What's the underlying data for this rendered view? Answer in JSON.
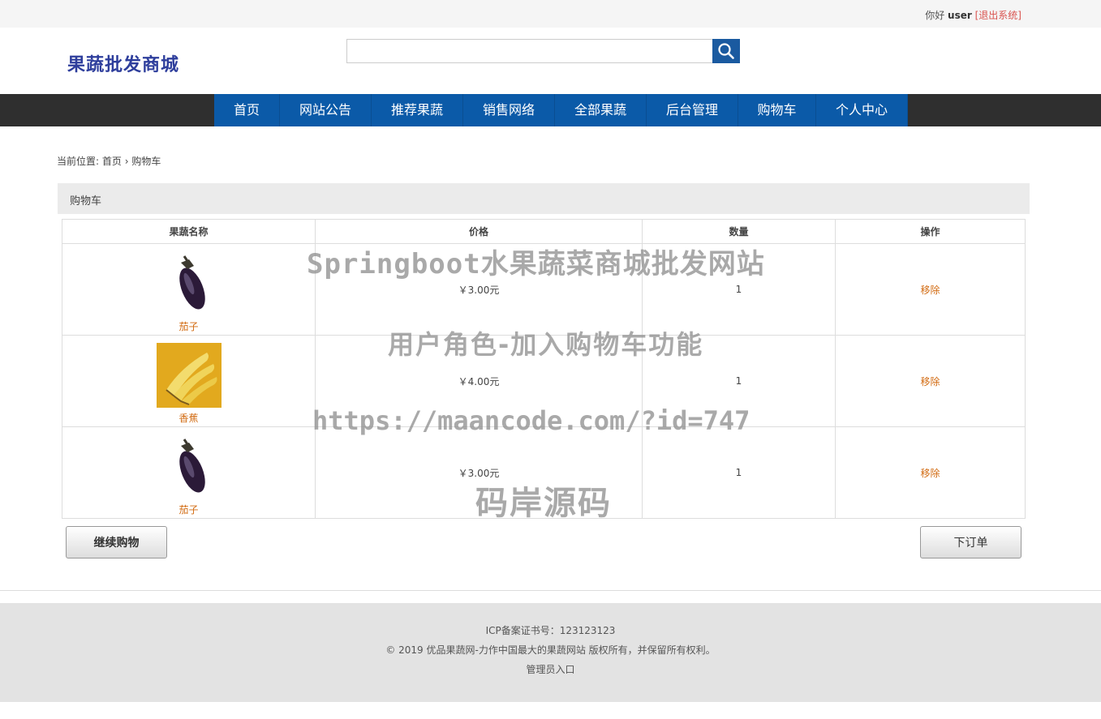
{
  "topbar": {
    "greeting": "你好",
    "username": "user",
    "logout": "[退出系统]"
  },
  "logo": "果蔬批发商城",
  "search": {
    "placeholder": "",
    "value": ""
  },
  "nav": [
    "首页",
    "网站公告",
    "推荐果蔬",
    "销售网络",
    "全部果蔬",
    "后台管理",
    "购物车",
    "个人中心"
  ],
  "breadcrumb": {
    "prefix": "当前位置:",
    "home": "首页",
    "sep": "›",
    "current": "购物车"
  },
  "section_title": "购物车",
  "table": {
    "headers": [
      "果蔬名称",
      "价格",
      "数量",
      "操作"
    ],
    "rows": [
      {
        "name": "茄子",
        "image": "eggplant",
        "price": "￥3.00元",
        "qty": "1",
        "action": "移除"
      },
      {
        "name": "香蕉",
        "image": "banana",
        "price": "￥4.00元",
        "qty": "1",
        "action": "移除"
      },
      {
        "name": "茄子",
        "image": "eggplant",
        "price": "￥3.00元",
        "qty": "1",
        "action": "移除"
      }
    ]
  },
  "buttons": {
    "continue": "继续购物",
    "order": "下订单"
  },
  "footer": {
    "icp": "ICP备案证书号：123123123",
    "copyright": "© 2019 优品果蔬网-力作中国最大的果蔬网站 版权所有，并保留所有权利。",
    "admin": "管理员入口"
  },
  "watermark": [
    "Springboot水果蔬菜商城批发网站",
    "用户角色-加入购物车功能",
    "https://maancode.com/?id=747",
    "码岸源码"
  ]
}
